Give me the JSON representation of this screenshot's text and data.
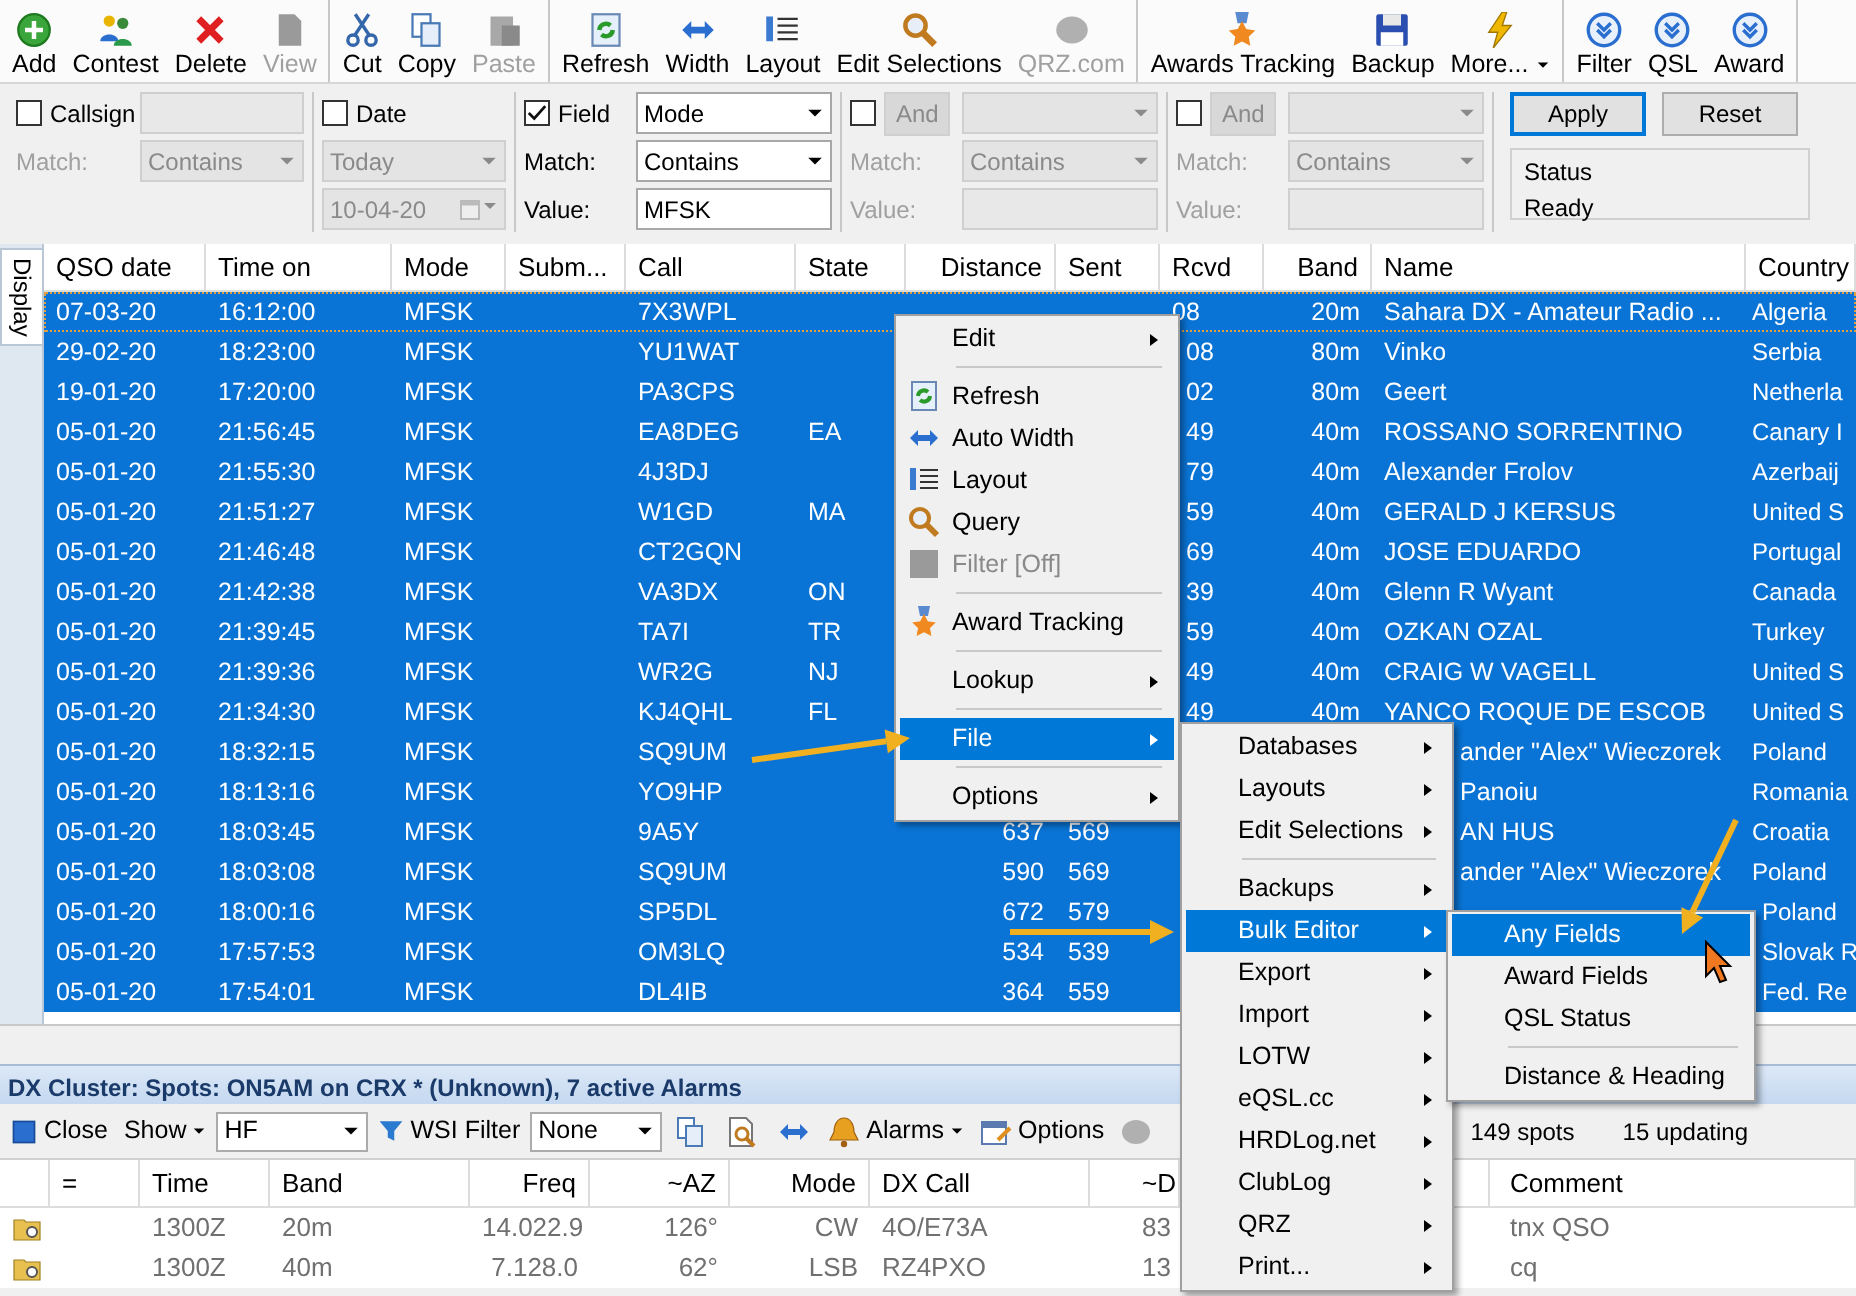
{
  "toolbar": [
    [
      {
        "label": "Add",
        "disabled": false,
        "dropdown": false
      },
      {
        "label": "Contest",
        "disabled": false,
        "dropdown": false
      },
      {
        "label": "Delete",
        "disabled": false,
        "dropdown": false
      },
      {
        "label": "View",
        "disabled": true,
        "dropdown": false
      }
    ],
    [
      {
        "label": "Cut",
        "disabled": false,
        "dropdown": false
      },
      {
        "label": "Copy",
        "disabled": false,
        "dropdown": false
      },
      {
        "label": "Paste",
        "disabled": true,
        "dropdown": false
      }
    ],
    [
      {
        "label": "Refresh",
        "disabled": false,
        "dropdown": false
      },
      {
        "label": "Width",
        "disabled": false,
        "dropdown": false
      },
      {
        "label": "Layout",
        "disabled": false,
        "dropdown": false
      },
      {
        "label": "Edit Selections",
        "disabled": false,
        "dropdown": false
      },
      {
        "label": "QRZ.com",
        "disabled": true,
        "dropdown": false
      }
    ],
    [
      {
        "label": "Awards Tracking",
        "disabled": false,
        "dropdown": false
      },
      {
        "label": "Backup",
        "disabled": false,
        "dropdown": false
      },
      {
        "label": "More...",
        "disabled": false,
        "dropdown": true
      }
    ],
    [
      {
        "label": "Filter",
        "disabled": false,
        "dropdown": false
      },
      {
        "label": "QSL",
        "disabled": false,
        "dropdown": false
      },
      {
        "label": "Award",
        "disabled": false,
        "dropdown": false
      }
    ]
  ],
  "filters": [
    {
      "kind": "text",
      "label": "Callsign",
      "checked": false,
      "match_label": "Match:",
      "match": "Contains"
    },
    {
      "kind": "date",
      "label": "Date",
      "checked": false,
      "range": "Today",
      "date": "10-04-20"
    },
    {
      "kind": "field",
      "label": "Field",
      "checked": true,
      "field": "Mode",
      "match_label": "Match:",
      "match": "Contains",
      "value_label": "Value:",
      "value": "MFSK"
    },
    {
      "kind": "and",
      "label": "And",
      "checked": false,
      "match_label": "Match:",
      "match": "Contains",
      "value_label": "Value:"
    },
    {
      "kind": "and",
      "label": "And",
      "checked": false,
      "match_label": "Match:",
      "match": "Contains",
      "value_label": "Value:"
    }
  ],
  "apply": "Apply",
  "reset": "Reset",
  "status": {
    "title": "Status",
    "text": "Ready"
  },
  "display_tab": "Display",
  "table": {
    "columns": [
      "QSO date",
      "Time on",
      "Mode",
      "Subm...",
      "Call",
      "State",
      "Distance",
      "Sent",
      "Rcvd",
      "Band",
      "Name",
      "Country"
    ],
    "rows": [
      {
        "selected": true,
        "focused": true,
        "cells": [
          "07-03-20",
          "16:12:00",
          "MFSK",
          null,
          "7X3WPL",
          null,
          null,
          null,
          "08",
          "20m",
          "Sahara DX - Amateur Radio ...",
          "Algeria"
        ]
      },
      {
        "selected": true,
        "focused": false,
        "cells": [
          "29-02-20",
          "18:23:00",
          "MFSK",
          null,
          "YU1WAT",
          null,
          null,
          null,
          "08",
          "80m",
          "Vinko",
          "Serbia"
        ]
      },
      {
        "selected": true,
        "focused": false,
        "cells": [
          "19-01-20",
          "17:20:00",
          "MFSK",
          null,
          "PA3CPS",
          null,
          null,
          null,
          "02",
          "80m",
          "Geert",
          "Netherla"
        ]
      },
      {
        "selected": true,
        "focused": false,
        "cells": [
          "05-01-20",
          "21:56:45",
          "MFSK",
          null,
          "EA8DEG",
          "EA",
          null,
          null,
          "49",
          "40m",
          "ROSSANO SORRENTINO",
          "Canary I"
        ]
      },
      {
        "selected": true,
        "focused": false,
        "cells": [
          "05-01-20",
          "21:55:30",
          "MFSK",
          null,
          "4J3DJ",
          null,
          null,
          null,
          "79",
          "40m",
          "Alexander Frolov",
          "Azerbaij"
        ]
      },
      {
        "selected": true,
        "focused": false,
        "cells": [
          "05-01-20",
          "21:51:27",
          "MFSK",
          null,
          "W1GD",
          "MA",
          null,
          null,
          "59",
          "40m",
          "GERALD J KERSUS",
          "United S"
        ]
      },
      {
        "selected": true,
        "focused": false,
        "cells": [
          "05-01-20",
          "21:46:48",
          "MFSK",
          null,
          "CT2GQN",
          null,
          null,
          null,
          "69",
          "40m",
          "JOSE EDUARDO",
          "Portugal"
        ]
      },
      {
        "selected": true,
        "focused": false,
        "cells": [
          "05-01-20",
          "21:42:38",
          "MFSK",
          null,
          "VA3DX",
          "ON",
          null,
          null,
          "39",
          "40m",
          "Glenn R Wyant",
          "Canada"
        ]
      },
      {
        "selected": true,
        "focused": false,
        "cells": [
          "05-01-20",
          "21:39:45",
          "MFSK",
          null,
          "TA7I",
          "TR",
          null,
          null,
          "59",
          "40m",
          "OZKAN OZAL",
          "Turkey"
        ]
      },
      {
        "selected": true,
        "focused": false,
        "cells": [
          "05-01-20",
          "21:39:36",
          "MFSK",
          null,
          "WR2G",
          "NJ",
          null,
          null,
          "49",
          "40m",
          "CRAIG W VAGELL",
          "United S"
        ]
      },
      {
        "selected": true,
        "focused": false,
        "cells": [
          "05-01-20",
          "21:34:30",
          "MFSK",
          null,
          "KJ4QHL",
          "FL",
          null,
          null,
          "49",
          "40m",
          "YANCO ROQUE DE ESCOB",
          "United S"
        ]
      },
      {
        "selected": true,
        "focused": false,
        "cells": [
          "05-01-20",
          "18:32:15",
          "MFSK",
          null,
          "SQ9UM",
          null,
          null,
          null,
          null,
          null,
          "ander \"Alex\" Wieczorek",
          "Poland"
        ]
      },
      {
        "selected": true,
        "focused": false,
        "cells": [
          "05-01-20",
          "18:13:16",
          "MFSK",
          null,
          "YO9HP",
          null,
          null,
          null,
          null,
          null,
          "Panoiu",
          "Romania"
        ]
      },
      {
        "selected": true,
        "focused": false,
        "cells": [
          "05-01-20",
          "18:03:45",
          "MFSK",
          null,
          "9A5Y",
          null,
          "637",
          "569",
          null,
          null,
          "AN HUS",
          "Croatia"
        ]
      },
      {
        "selected": true,
        "focused": false,
        "cells": [
          "05-01-20",
          "18:03:08",
          "MFSK",
          null,
          "SQ9UM",
          null,
          "590",
          "569",
          null,
          null,
          "ander \"Alex\" Wieczorek",
          "Poland"
        ]
      },
      {
        "selected": true,
        "focused": false,
        "cells": [
          "05-01-20",
          "18:00:16",
          "MFSK",
          null,
          "SP5DL",
          null,
          "672",
          "579",
          null,
          null,
          null,
          "Poland"
        ]
      },
      {
        "selected": true,
        "focused": false,
        "cells": [
          "05-01-20",
          "17:57:53",
          "MFSK",
          null,
          "OM3LQ",
          null,
          "534",
          "539",
          null,
          null,
          null,
          "Slovak R"
        ]
      },
      {
        "selected": true,
        "focused": false,
        "cells": [
          "05-01-20",
          "17:54:01",
          "MFSK",
          null,
          "DL4IB",
          null,
          "364",
          "559",
          null,
          null,
          null,
          "Fed. Re"
        ]
      }
    ]
  },
  "context_menu": [
    {
      "kind": "item",
      "label": "Edit",
      "submenu": true,
      "selected": false,
      "disabled": false
    },
    {
      "kind": "separator"
    },
    {
      "kind": "item",
      "label": "Refresh",
      "submenu": false,
      "selected": false,
      "disabled": false
    },
    {
      "kind": "item",
      "label": "Auto Width",
      "submenu": false,
      "selected": false,
      "disabled": false
    },
    {
      "kind": "item",
      "label": "Layout",
      "submenu": false,
      "selected": false,
      "disabled": false
    },
    {
      "kind": "item",
      "label": "Query",
      "submenu": false,
      "selected": false,
      "disabled": false
    },
    {
      "kind": "item",
      "label": "Filter [Off]",
      "submenu": false,
      "selected": false,
      "disabled": true
    },
    {
      "kind": "separator"
    },
    {
      "kind": "item",
      "label": "Award Tracking",
      "submenu": false,
      "selected": false,
      "disabled": false
    },
    {
      "kind": "separator"
    },
    {
      "kind": "item",
      "label": "Lookup",
      "submenu": true,
      "selected": false,
      "disabled": false
    },
    {
      "kind": "separator"
    },
    {
      "kind": "item",
      "label": "File",
      "submenu": true,
      "selected": true,
      "disabled": false
    },
    {
      "kind": "separator"
    },
    {
      "kind": "item",
      "label": "Options",
      "submenu": true,
      "selected": false,
      "disabled": false
    }
  ],
  "file_menu": [
    {
      "kind": "item",
      "label": "Databases",
      "submenu": true,
      "selected": false,
      "disabled": false
    },
    {
      "kind": "item",
      "label": "Layouts",
      "submenu": true,
      "selected": false,
      "disabled": false
    },
    {
      "kind": "item",
      "label": "Edit Selections",
      "submenu": true,
      "selected": false,
      "disabled": false
    },
    {
      "kind": "separator"
    },
    {
      "kind": "item",
      "label": "Backups",
      "submenu": true,
      "selected": false,
      "disabled": false
    },
    {
      "kind": "item",
      "label": "Bulk Editor",
      "submenu": true,
      "selected": true,
      "disabled": false
    },
    {
      "kind": "item",
      "label": "Export",
      "submenu": true,
      "selected": false,
      "disabled": false
    },
    {
      "kind": "item",
      "label": "Import",
      "submenu": true,
      "selected": false,
      "disabled": false
    },
    {
      "kind": "item",
      "label": "LOTW",
      "submenu": true,
      "selected": false,
      "disabled": false
    },
    {
      "kind": "item",
      "label": "eQSL.cc",
      "submenu": true,
      "selected": false,
      "disabled": false
    },
    {
      "kind": "item",
      "label": "HRDLog.net",
      "submenu": true,
      "selected": false,
      "disabled": false
    },
    {
      "kind": "item",
      "label": "ClubLog",
      "submenu": true,
      "selected": false,
      "disabled": false
    },
    {
      "kind": "item",
      "label": "QRZ",
      "submenu": true,
      "selected": false,
      "disabled": false
    },
    {
      "kind": "item",
      "label": "Print...",
      "submenu": true,
      "selected": false,
      "disabled": false
    }
  ],
  "bulk_menu": [
    {
      "kind": "item",
      "label": "Any Fields",
      "submenu": false,
      "selected": true,
      "disabled": false
    },
    {
      "kind": "item",
      "label": "Award Fields",
      "submenu": false,
      "selected": false,
      "disabled": false
    },
    {
      "kind": "item",
      "label": "QSL Status",
      "submenu": false,
      "selected": false,
      "disabled": false
    },
    {
      "kind": "separator"
    },
    {
      "kind": "item",
      "label": "Distance & Heading",
      "submenu": false,
      "selected": false,
      "disabled": false
    }
  ],
  "cluster": {
    "title": "DX Cluster: Spots: ON5AM on CRX * (Unknown), 7 active Alarms",
    "toolbar": {
      "close": "Close",
      "show": "Show",
      "band": "HF",
      "wsi_filter": "WSI Filter",
      "wsi_value": "None",
      "alarms": "Alarms",
      "options": "Options",
      "spots": "149 spots",
      "updating": "15 updating"
    },
    "columns": [
      "=",
      "Time",
      "Band",
      "Freq",
      "~AZ",
      "Mode",
      "DX Call",
      "~D",
      "Comment"
    ],
    "rows": [
      {
        "cells": [
          null,
          "1300Z",
          "20m",
          "14.022.9",
          "126°",
          "CW",
          "4O/E73A",
          "83",
          "tnx QSO"
        ]
      },
      {
        "cells": [
          null,
          "1300Z",
          "40m",
          "7.128.0",
          "62°",
          "LSB",
          "RZ4PXO",
          "13",
          "cq"
        ]
      }
    ]
  }
}
